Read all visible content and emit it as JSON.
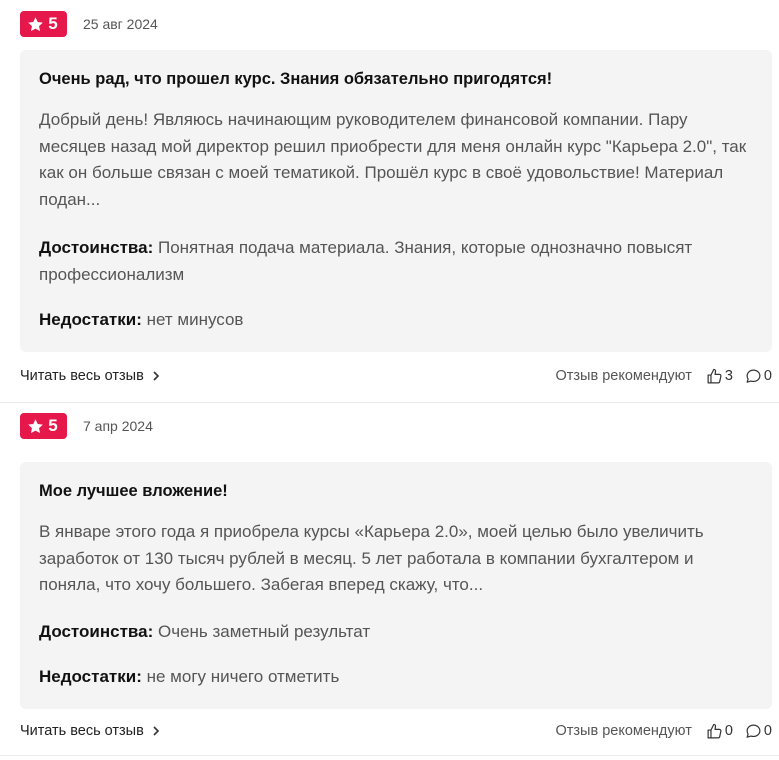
{
  "colors": {
    "badge": "#e6174b",
    "card_bg": "#f4f4f5"
  },
  "reviews": [
    {
      "rating": "5",
      "date": "25 авг 2024",
      "title": "Очень рад, что прошел курс. Знания обязательно пригодятся!",
      "text": "Добрый день! Являюсь начинающим руководителем финансовой компании. Пару месяцев назад мой директор решил приобрести для меня онлайн курс \"Карьера 2.0\", так как он больше связан с моей тематикой. Прошёл курс в своё удовольствие! Материал подан...",
      "pros_label": "Достоинства:",
      "pros": "Понятная подача материала. Знания, которые однозначно повысят профессионализм",
      "cons_label": "Недостатки:",
      "cons": "нет минусов",
      "read_more": "Читать весь отзыв",
      "recommend": "Отзыв рекомендуют",
      "likes": "3",
      "comments": "0"
    },
    {
      "rating": "5",
      "date": "7 апр 2024",
      "title": "Мое лучшее вложение!",
      "text": "В январе этого года я приобрела курсы «Карьера 2.0», моей целью было увеличить заработок от 130 тысяч рублей в месяц. 5 лет работала в компании бухгалтером и поняла, что хочу большего. Забегая вперед скажу, что...",
      "pros_label": "Достоинства:",
      "pros": "Очень заметный результат",
      "cons_label": "Недостатки:",
      "cons": "не могу ничего отметить",
      "read_more": "Читать весь отзыв",
      "recommend": "Отзыв рекомендуют",
      "likes": "0",
      "comments": "0"
    }
  ]
}
